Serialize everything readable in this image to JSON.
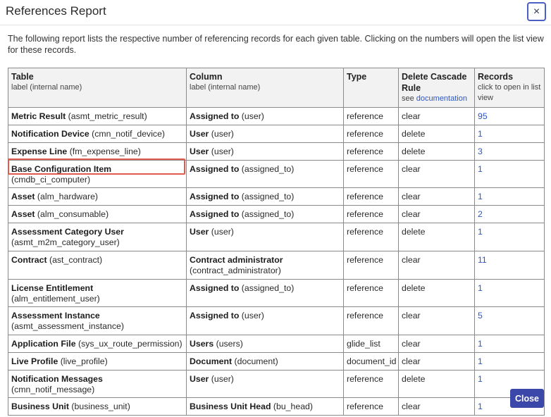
{
  "dialog": {
    "title": "References Report",
    "close_icon": "×",
    "intro": "The following report lists the respective number of referencing records for each given table. Clicking on the numbers will open the list view for these records.",
    "close_button": "Close"
  },
  "table": {
    "headers": {
      "table": {
        "title": "Table",
        "sub": "label (internal name)"
      },
      "column": {
        "title": "Column",
        "sub": "label (internal name)"
      },
      "type": {
        "title": "Type"
      },
      "rule": {
        "title": "Delete Cascade Rule",
        "sub_prefix": "see ",
        "sub_link": "documentation"
      },
      "records": {
        "title": "Records",
        "sub": "click to open in list view"
      }
    },
    "rows": [
      {
        "table_label": "Metric Result",
        "table_name": " (asmt_metric_result)",
        "col_label": "Assigned to",
        "col_name": " (user)",
        "type": "reference",
        "rule": "clear",
        "records": "95"
      },
      {
        "table_label": "Notification Device",
        "table_name": " (cmn_notif_device)",
        "col_label": "User",
        "col_name": " (user)",
        "type": "reference",
        "rule": "delete",
        "records": "1"
      },
      {
        "table_label": "Expense Line",
        "table_name": " (fm_expense_line)",
        "col_label": "User",
        "col_name": " (user)",
        "type": "reference",
        "rule": "delete",
        "records": "3"
      },
      {
        "table_label": "Base Configuration Item",
        "table_name": " (cmdb_ci_computer)",
        "col_label": "Assigned to",
        "col_name": " (assigned_to)",
        "type": "reference",
        "rule": "clear",
        "records": "1"
      },
      {
        "table_label": "Asset",
        "table_name": " (alm_hardware)",
        "col_label": "Assigned to",
        "col_name": " (assigned_to)",
        "type": "reference",
        "rule": "clear",
        "records": "1"
      },
      {
        "table_label": "Asset",
        "table_name": " (alm_consumable)",
        "col_label": "Assigned to",
        "col_name": " (assigned_to)",
        "type": "reference",
        "rule": "clear",
        "records": "2"
      },
      {
        "table_label": "Assessment Category User",
        "table_name": " (asmt_m2m_category_user)",
        "col_label": "User",
        "col_name": " (user)",
        "type": "reference",
        "rule": "delete",
        "records": "1"
      },
      {
        "table_label": "Contract",
        "table_name": " (ast_contract)",
        "col_label": "Contract administrator",
        "col_name": " (contract_administrator)",
        "type": "reference",
        "rule": "clear",
        "records": "11"
      },
      {
        "table_label": "License Entitlement",
        "table_name": " (alm_entitlement_user)",
        "col_label": "Assigned to",
        "col_name": " (assigned_to)",
        "type": "reference",
        "rule": "delete",
        "records": "1"
      },
      {
        "table_label": "Assessment Instance",
        "table_name": " (asmt_assessment_instance)",
        "col_label": "Assigned to",
        "col_name": " (user)",
        "type": "reference",
        "rule": "clear",
        "records": "5"
      },
      {
        "table_label": "Application File",
        "table_name": " (sys_ux_route_permission)",
        "col_label": "Users",
        "col_name": " (users)",
        "type": "glide_list",
        "rule": "clear",
        "records": "1"
      },
      {
        "table_label": "Live Profile",
        "table_name": " (live_profile)",
        "col_label": "Document",
        "col_name": " (document)",
        "type": "document_id",
        "rule": "clear",
        "records": "1"
      },
      {
        "table_label": "Notification Messages",
        "table_name": " (cmn_notif_message)",
        "col_label": "User",
        "col_name": " (user)",
        "type": "reference",
        "rule": "delete",
        "records": "1"
      },
      {
        "table_label": "Business Unit",
        "table_name": " (business_unit)",
        "col_label": "Business Unit Head",
        "col_name": " (bu_head)",
        "type": "reference",
        "rule": "clear",
        "records": "1"
      }
    ]
  }
}
